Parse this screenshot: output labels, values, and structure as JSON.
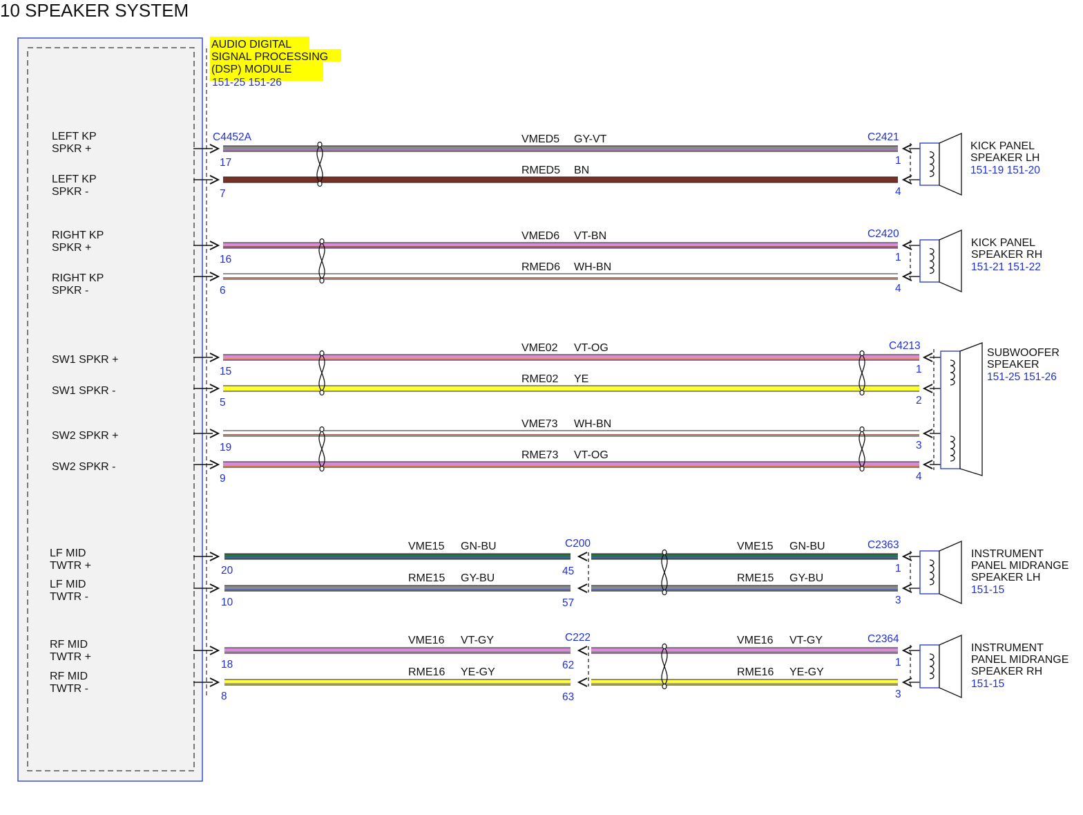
{
  "title": "10 SPEAKER SYSTEM",
  "module": {
    "name_lines": [
      "AUDIO DIGITAL",
      "SIGNAL PROCESSING",
      "(DSP) MODULE"
    ],
    "ref": "151-25  151-26",
    "connector": "C4452A",
    "highlight_color": "#ffff00",
    "pin_labels": [
      [
        "LEFT KP",
        "SPKR +"
      ],
      [
        "LEFT KP",
        "SPKR -"
      ],
      [
        "RIGHT KP",
        "SPKR +"
      ],
      [
        "RIGHT KP",
        "SPKR -"
      ],
      [
        "SW1 SPKR +"
      ],
      [
        "SW1 SPKR -"
      ],
      [
        "SW2 SPKR +"
      ],
      [
        "SW2 SPKR -"
      ],
      [
        "LF MID",
        "TWTR +"
      ],
      [
        "LF MID",
        "TWTR -"
      ],
      [
        "RF MID",
        "TWTR +"
      ],
      [
        "RF MID",
        "TWTR -"
      ]
    ]
  },
  "circuits": [
    {
      "circuit": "VMED5",
      "color_code": "GY-VT",
      "module_pin": "17",
      "far_pin": "1",
      "far_connector": "C2421",
      "colors": [
        "#8a8a8a",
        "#b46fd0"
      ]
    },
    {
      "circuit": "RMED5",
      "color_code": "BN",
      "module_pin": "7",
      "far_pin": "4",
      "far_connector": "",
      "colors": [
        "#7a2f24",
        "#7a2f24"
      ]
    },
    {
      "circuit": "VMED6",
      "color_code": "VT-BN",
      "module_pin": "16",
      "far_pin": "1",
      "far_connector": "C2420",
      "colors": [
        "#d88bd8",
        "#8c4a2f"
      ]
    },
    {
      "circuit": "RMED6",
      "color_code": "WH-BN",
      "module_pin": "6",
      "far_pin": "4",
      "far_connector": "",
      "colors": [
        "#ffffff",
        "#8c4a2f"
      ]
    },
    {
      "circuit": "VME02",
      "color_code": "VT-OG",
      "module_pin": "15",
      "far_pin": "1",
      "far_connector": "C4213",
      "colors": [
        "#d88bd8",
        "#f08a2a"
      ]
    },
    {
      "circuit": "RME02",
      "color_code": "YE",
      "module_pin": "5",
      "far_pin": "2",
      "far_connector": "",
      "colors": [
        "#ffff33",
        "#ffff33"
      ]
    },
    {
      "circuit": "VME73",
      "color_code": "WH-BN",
      "module_pin": "19",
      "far_pin": "3",
      "far_connector": "",
      "colors": [
        "#ffffff",
        "#8c4a2f"
      ]
    },
    {
      "circuit": "RME73",
      "color_code": "VT-OG",
      "module_pin": "9",
      "far_pin": "4",
      "far_connector": "",
      "colors": [
        "#d88bd8",
        "#f08a2a"
      ]
    },
    {
      "circuit": "VME15",
      "color_code": "GN-BU",
      "module_pin": "20",
      "inline_connector": "C200",
      "inline_pin": "45",
      "far_pin": "1",
      "far_connector": "C2363",
      "colors": [
        "#2f6e4a",
        "#4a5fc8"
      ]
    },
    {
      "circuit": "RME15",
      "color_code": "GY-BU",
      "module_pin": "10",
      "inline_connector": "",
      "inline_pin": "57",
      "far_pin": "3",
      "far_connector": "",
      "colors": [
        "#8a8a8a",
        "#4a5fc8"
      ]
    },
    {
      "circuit": "VME16",
      "color_code": "VT-GY",
      "module_pin": "18",
      "inline_connector": "C222",
      "inline_pin": "62",
      "far_pin": "1",
      "far_connector": "C2364",
      "colors": [
        "#d88bd8",
        "#8a8a8a"
      ]
    },
    {
      "circuit": "RME16",
      "color_code": "YE-GY",
      "module_pin": "8",
      "inline_connector": "",
      "inline_pin": "63",
      "far_pin": "3",
      "far_connector": "",
      "colors": [
        "#ffff33",
        "#8a8a8a"
      ]
    }
  ],
  "speakers": [
    {
      "lines": [
        "KICK PANEL",
        "SPEAKER LH"
      ],
      "ref": "151-19  151-20"
    },
    {
      "lines": [
        "KICK PANEL",
        "SPEAKER RH"
      ],
      "ref": "151-21  151-22"
    },
    {
      "lines": [
        "SUBWOOFER",
        "SPEAKER"
      ],
      "ref": "151-25  151-26"
    },
    {
      "lines": [
        "INSTRUMENT",
        "PANEL MIDRANGE",
        "SPEAKER LH"
      ],
      "ref": "151-15"
    },
    {
      "lines": [
        "INSTRUMENT",
        "PANEL MIDRANGE",
        "SPEAKER RH"
      ],
      "ref": "151-15"
    }
  ],
  "colors": {
    "link_blue": "#1f2fd6",
    "module_fill": "#f2f2f2",
    "module_border": "#3b4fd1"
  }
}
